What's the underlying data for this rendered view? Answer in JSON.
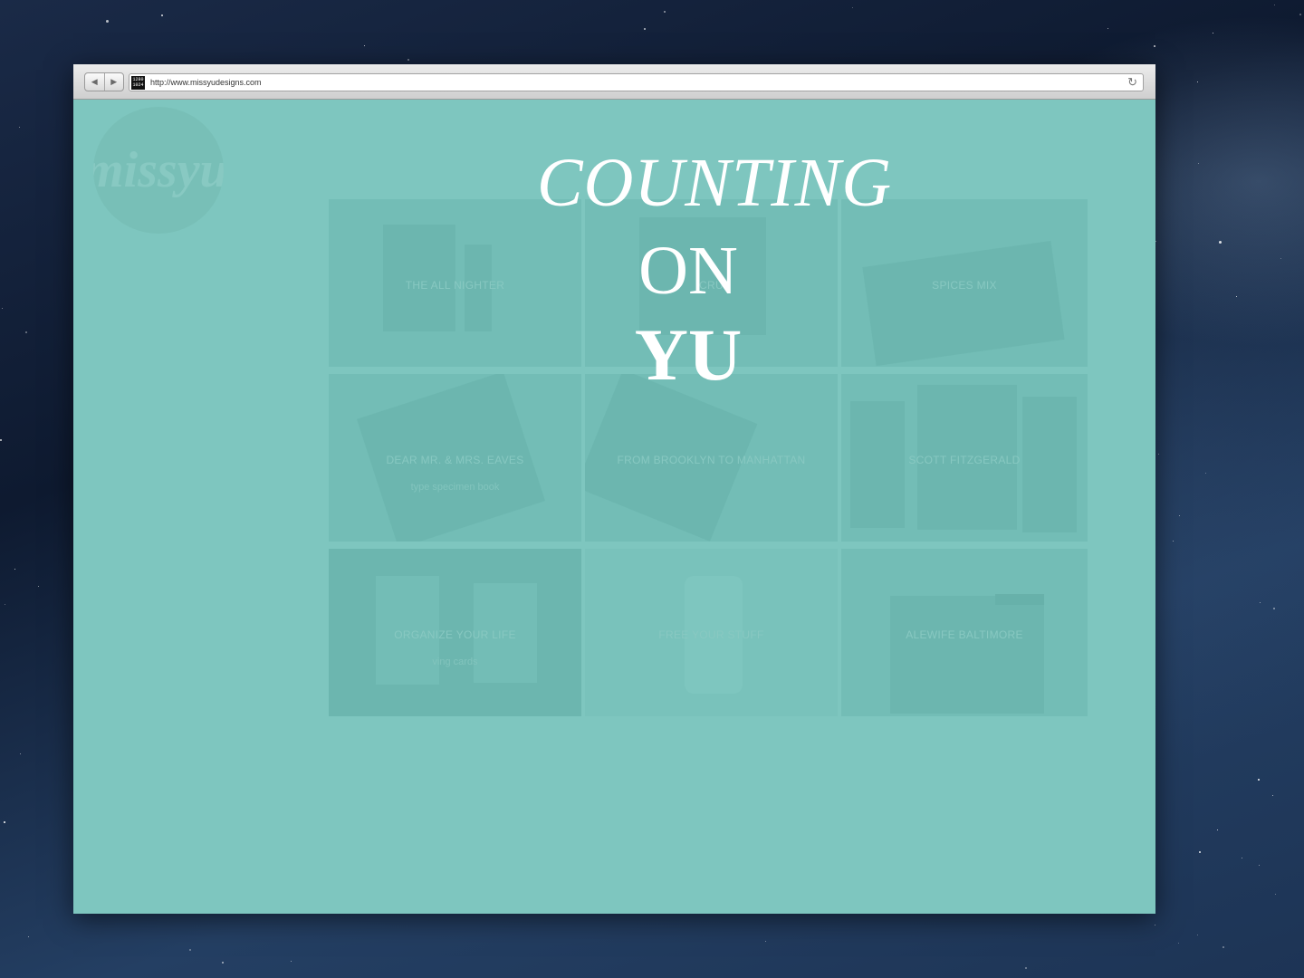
{
  "browser": {
    "url": "http://www.missyudesigns.com",
    "favicon_text": [
      "1280",
      "1024"
    ],
    "back_icon": "back-arrow-icon",
    "forward_icon": "forward-arrow-icon",
    "reload_icon": "reload-icon"
  },
  "site": {
    "logo_text": "missyu",
    "headline": {
      "line1": "COUNTING",
      "line2": "ON",
      "line3": "YU"
    },
    "portfolio": [
      {
        "title": "THE ALL NIGHTER",
        "subtitle": ""
      },
      {
        "title": "CRU",
        "subtitle": ""
      },
      {
        "title": "SPICES MIX",
        "subtitle": ""
      },
      {
        "title": "DEAR MR. & MRS. EAVES",
        "subtitle": "type specimen book"
      },
      {
        "title": "FROM BROOKLYN TO MANHATTAN",
        "subtitle": ""
      },
      {
        "title": "SCOTT FITZGERALD",
        "subtitle": ""
      },
      {
        "title": "ORGANIZE YOUR LIFE",
        "subtitle": "ving cards"
      },
      {
        "title": "FREE YOUR STUFF",
        "subtitle": ""
      },
      {
        "title": "ALEWIFE BALTIMORE",
        "subtitle": ""
      }
    ]
  },
  "colors": {
    "page_background": "#7fc7bf",
    "tile": "#6fbab3",
    "headline": "#ffffff"
  }
}
